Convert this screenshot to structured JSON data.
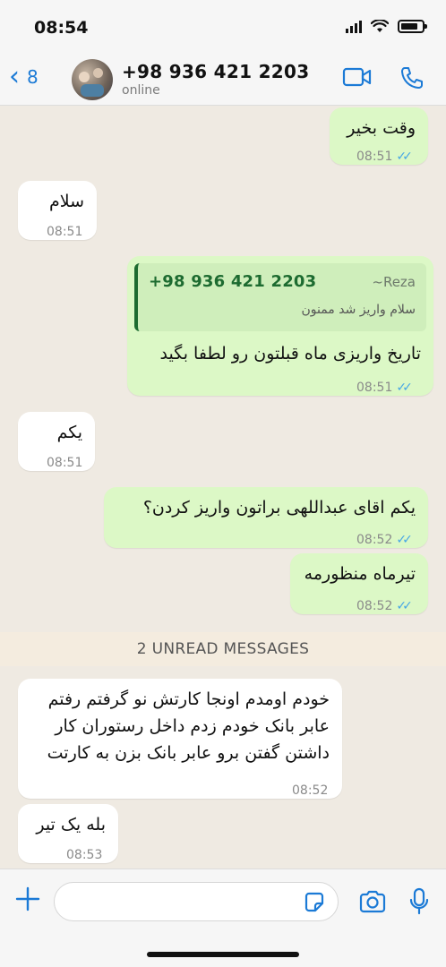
{
  "status_bar": {
    "time": "08:54"
  },
  "header": {
    "back_count": "8",
    "contact_name": "+98 936 421 2203",
    "contact_status": "online"
  },
  "messages": [
    {
      "direction": "out",
      "text": "وقت بخیر",
      "time": "08:51",
      "read": true
    },
    {
      "direction": "in",
      "text": "سلام",
      "time": "08:51"
    },
    {
      "direction": "out",
      "quote": {
        "sender": "+98 936 421 2203",
        "tag": "~Reza",
        "text": "سلام واریز شد ممنون"
      },
      "text": "تاریخ واریزی ماه قبلتون رو لطفا بگید",
      "time": "08:51",
      "read": true
    },
    {
      "direction": "in",
      "text": "یکم",
      "time": "08:51"
    },
    {
      "direction": "out",
      "text": "یکم اقای عبداللهی براتون واریز کردن؟",
      "time": "08:52",
      "read": true
    },
    {
      "direction": "out",
      "text": "تیرماه منظورمه",
      "time": "08:52",
      "read": true
    },
    {
      "direction": "in",
      "lines": [
        "خودم اومدم اونجا کارتش نو گرفتم رفتم",
        "عابر بانک خودم زدم داخل رستوران کار",
        "داشتن گفتن برو عابر بانک بزن به کارتت"
      ],
      "time": "08:52"
    },
    {
      "direction": "in",
      "text": "بله یک تیر",
      "time": "08:53"
    }
  ],
  "unread_divider": "2 UNREAD MESSAGES",
  "composer": {
    "value": "",
    "placeholder": ""
  },
  "colors": {
    "accent": "#1b7ad6",
    "outgoing_bubble": "#dcf8c6",
    "incoming_bubble": "#ffffff",
    "read_ticks": "#48a7e5"
  },
  "icons": [
    "signal-icon",
    "wifi-icon",
    "battery-icon",
    "back-chevron-icon",
    "video-call-icon",
    "phone-icon",
    "plus-icon",
    "sticker-icon",
    "camera-icon",
    "microphone-icon",
    "double-check-icon"
  ]
}
